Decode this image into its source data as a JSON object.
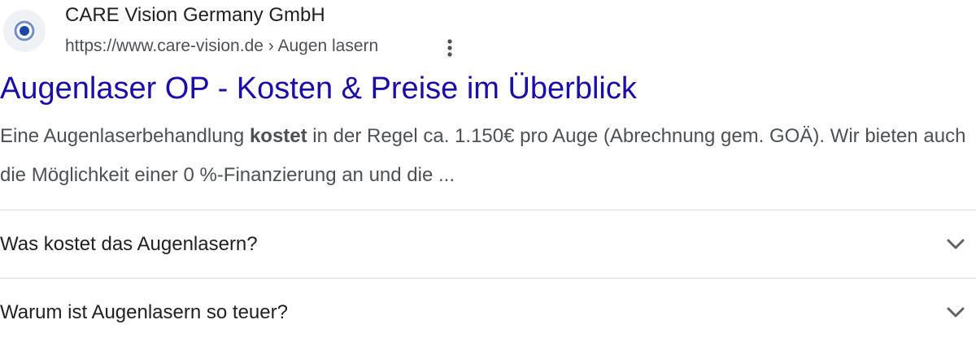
{
  "site": {
    "name": "CARE Vision Germany GmbH",
    "url": "https://www.care-vision.de",
    "breadcrumb_separator": " › ",
    "breadcrumb": "Augen lasern",
    "favicon_icon": "target-dot-icon",
    "more_icon": "more-vertical-icon"
  },
  "result": {
    "title": "Augenlaser OP - Kosten & Preise im Überblick",
    "snippet_before_bold": "Eine Augenlaserbehandlung ",
    "snippet_bold": "kostet",
    "snippet_after_bold": " in der Regel ca. 1.150€ pro Auge (Abrechnung gem. GOÄ). Wir bieten auch die Möglichkeit einer 0 %-Finanzierung an und die ..."
  },
  "faq": [
    {
      "question": "Was kostet das Augenlasern?",
      "icon": "chevron-down-icon"
    },
    {
      "question": "Warum ist Augenlasern so teuer?",
      "icon": "chevron-down-icon"
    }
  ],
  "colors": {
    "link": "#1a0dab",
    "text": "#202124",
    "snippet": "#4d5156",
    "divider": "#dadce0",
    "favicon_blue": "#1a47a8"
  }
}
